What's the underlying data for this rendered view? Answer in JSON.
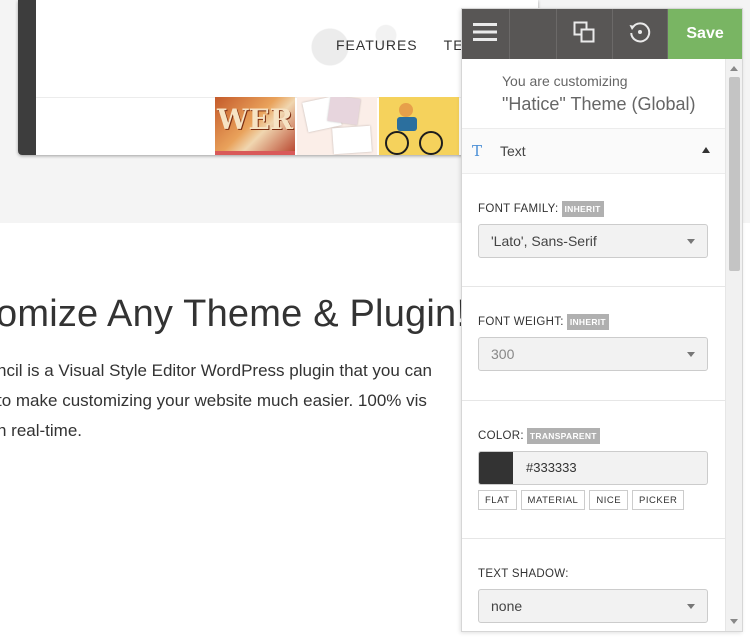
{
  "site": {
    "nav": [
      "FEATURES",
      "TEST D"
    ],
    "thumb_word": "WER",
    "headline": "omize Any Theme & Plugin!",
    "description_lines": [
      "ncil is a Visual Style Editor WordPress plugin that you can",
      "to make customizing your website much easier. 100% vis",
      "n real-time."
    ]
  },
  "panel": {
    "toolbar": {
      "menu_icon": "hamburger-icon",
      "responsive_icon": "responsive-devices-icon",
      "history_icon": "history-icon",
      "save_label": "Save",
      "save_color": "#79b563",
      "bg_color": "#585655"
    },
    "header": {
      "subtitle": "You are customizing",
      "title": "\"Hatice\" Theme (Global)"
    },
    "section": {
      "icon": "T",
      "label": "Text"
    },
    "fields": {
      "font_family": {
        "label": "FONT FAMILY:",
        "badge": "INHERIT",
        "value": "'Lato', Sans-Serif"
      },
      "font_weight": {
        "label": "FONT WEIGHT:",
        "badge": "INHERIT",
        "value": "300"
      },
      "color": {
        "label": "COLOR:",
        "badge": "TRANSPARENT",
        "value": "#333333",
        "palettes": [
          "FLAT",
          "MATERIAL",
          "NICE",
          "PICKER"
        ]
      },
      "text_shadow": {
        "label": "TEXT SHADOW:",
        "value": "none"
      }
    }
  }
}
